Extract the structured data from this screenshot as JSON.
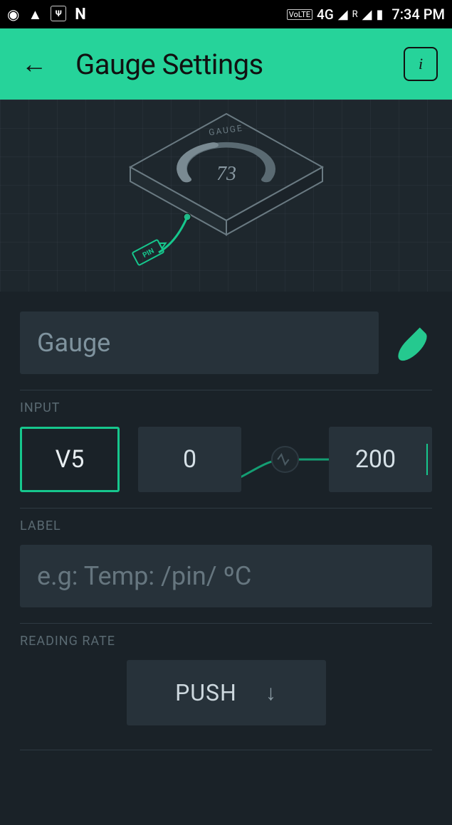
{
  "status": {
    "network_label": "4G",
    "roaming": "R",
    "volte": "VoLTE",
    "time": "7:34 PM"
  },
  "header": {
    "title": "Gauge Settings"
  },
  "preview": {
    "widget_label": "GAUGE",
    "value": "73",
    "pin_tag": "PIN"
  },
  "form": {
    "name_value": "Gauge",
    "accent_color": "#25c98f",
    "sections": {
      "input": "INPUT",
      "label": "LABEL",
      "reading_rate": "READING RATE"
    },
    "pin": "V5",
    "range_min": "0",
    "range_max": "200",
    "label_placeholder": "e.g: Temp: /pin/ ºC",
    "label_value": "",
    "reading_rate_value": "PUSH"
  }
}
